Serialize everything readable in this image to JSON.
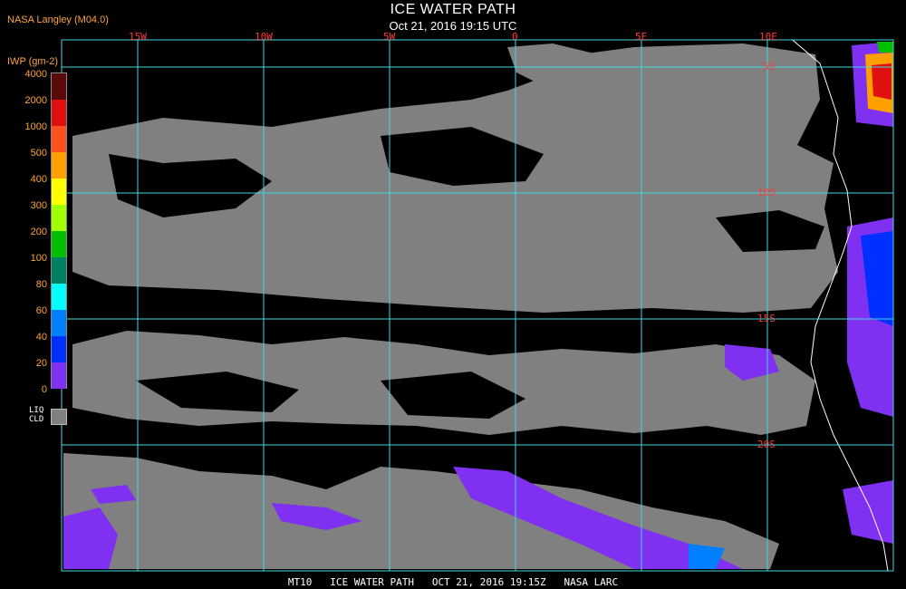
{
  "header": {
    "title": "ICE WATER PATH",
    "subtitle": "Oct 21, 2016 19:15 UTC",
    "source": "NASA Langley (M04.0)"
  },
  "grid": {
    "longitudes": [
      "15W",
      "10W",
      "5W",
      "0",
      "5E",
      "10E"
    ],
    "latitudes": [
      "5S",
      "10S",
      "15S",
      "20S"
    ]
  },
  "legend": {
    "title": "IWP (gm-2)",
    "ticks": [
      "4000",
      "2000",
      "1000",
      "500",
      "400",
      "300",
      "200",
      "100",
      "80",
      "60",
      "40",
      "20",
      "0"
    ],
    "colors": [
      "#5a0a0a",
      "#e01010",
      "#ff5020",
      "#ffa000",
      "#ffff00",
      "#a0ff00",
      "#00c000",
      "#008060",
      "#00ffff",
      "#0080ff",
      "#0030ff",
      "#8030f0"
    ],
    "liquid_label_line1": "LIQ",
    "liquid_label_line2": "CLD",
    "liquid_color": "#808080"
  },
  "footer": {
    "text": "MT10   ICE WATER PATH   OCT 21, 2016 19:15Z   NASA LARC"
  }
}
